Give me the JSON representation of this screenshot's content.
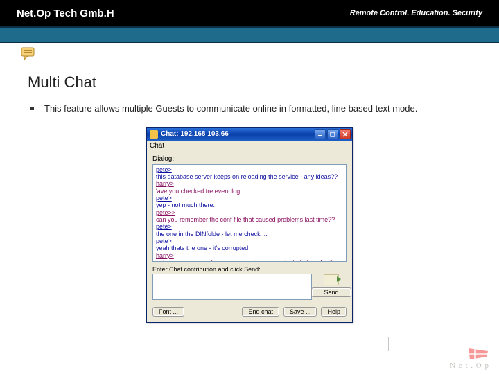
{
  "header": {
    "company": "Net.Op Tech Gmb.H",
    "tagline": "Remote Control. Education. Security"
  },
  "title": "Multi Chat",
  "bullet": "This feature allows multiple Guests to communicate online in formatted, line based text mode.",
  "chat": {
    "title": "Chat: 192.168 103.66",
    "menu": "Chat",
    "dialog_label": "Dialog:",
    "messages": [
      {
        "color": "#1010a0",
        "author": "pete>",
        "text": "this database server keeps on reloading the service - any ideas??"
      },
      {
        "color": "#8a1060",
        "author": "harry>",
        "text": "'ave you checked tre event log..."
      },
      {
        "color": "#1010a0",
        "author": "pete>",
        "text": "yep - not much there."
      },
      {
        "color": "#8a1060",
        "author": "pete>>",
        "text": "can you remember the conf file that caused problems last time??"
      },
      {
        "color": "#1010a0",
        "author": "pete>",
        "text": "the one in the DINfolde - let me check ..."
      },
      {
        "color": "#1010a0",
        "author": "pete>",
        "text": "yeah thats the one - it's corrupted"
      },
      {
        "color": "#8a1060",
        "author": "harry>",
        "text": "got a copy on one of my servers - give me a minute to transfer it"
      }
    ],
    "contrib_label": "Enter Chat contribution and click Send:",
    "send": "Send",
    "font": "Font ...",
    "endchat": "End chat",
    "save": "Save ...",
    "help": "Help"
  },
  "footer_brand": "N e t . O p"
}
